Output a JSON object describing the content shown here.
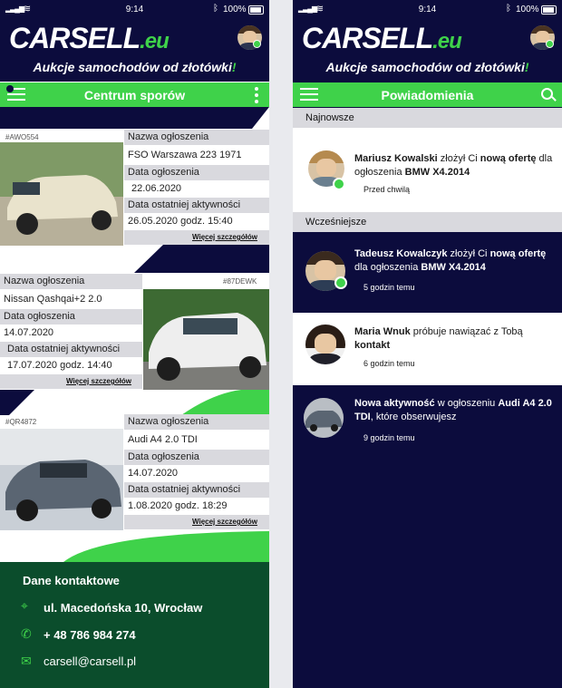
{
  "status_bar": {
    "time": "9:14",
    "battery": "100%"
  },
  "brand": {
    "logo_main": "CARSELL",
    "logo_suffix": ".eu",
    "tagline": "Aukcje samochodów od złotówki",
    "tagline_mark": "!"
  },
  "screen_disputes": {
    "bar_title": "Centrum sporów",
    "listings": [
      {
        "id": "#AWO554",
        "name_label": "Nazwa ogłoszenia",
        "name": "FSO Warszawa 223 1971",
        "date_label": "Data ogłoszenia",
        "date": "22.06.2020",
        "activity_label": "Data ostatniej aktywności",
        "activity": "26.05.2020 godz. 15:40",
        "more": "Więcej szczegółów",
        "photo": "vintage-car-photo"
      },
      {
        "id": "#87DEWK",
        "name_label": "Nazwa ogłoszenia",
        "name": "Nissan Qashqai+2 2.0",
        "date_label": "Data ogłoszenia",
        "date": "14.07.2020",
        "activity_label": "Data ostatniej aktywności",
        "activity": "17.07.2020 godz. 14:40",
        "more": "Więcej szczegółów",
        "photo": "suv-car-photo"
      },
      {
        "id": "#QR4872",
        "name_label": "Nazwa ogłoszenia",
        "name": "Audi A4 2.0 TDI",
        "date_label": "Data ogłoszenia",
        "date": "14.07.2020",
        "activity_label": "Data ostatniej aktywności",
        "activity": "1.08.2020 godz. 18:29",
        "more": "Więcej szczegółów",
        "photo": "sedan-car-photo"
      }
    ],
    "contact": {
      "heading": "Dane kontaktowe",
      "address": "ul. Macedońska 10, Wrocław",
      "phone": "+ 48 786 984 274",
      "email": "carsell@carsell.pl"
    }
  },
  "screen_notifications": {
    "bar_title": "Powiadomienia",
    "section_new": "Najnowsze",
    "section_earlier": "Wcześniejsze",
    "items": [
      {
        "p1": "Mariusz Kowalski",
        "p2": " złożył Ci ",
        "p3": "nową ofertę",
        "p4": " dla ogłoszenia ",
        "p5": "BMW X4.2014",
        "time": "Przed chwilą"
      },
      {
        "p1": "Tadeusz Kowalczyk",
        "p2": " złożył Ci ",
        "p3": "nową ofertę",
        "p4": " dla ogłoszenia ",
        "p5": "BMW X4.2014",
        "time": "5 godzin temu"
      },
      {
        "p1": "Maria Wnuk",
        "p2": " próbuje nawiązać z Tobą ",
        "p3": "kontakt",
        "time": "6 godzin temu"
      },
      {
        "p1": "Nowa aktywność",
        "p2": " w ogłoszeniu ",
        "p3": "Audi A4 2.0 TDI",
        "p4": ", które obserwujesz",
        "time": "9 godzin temu"
      }
    ]
  },
  "colors": {
    "navy": "#0c0c3d",
    "green": "#3fd24a",
    "dark_green": "#0b4d2c",
    "light_gray": "#d9d9de"
  }
}
